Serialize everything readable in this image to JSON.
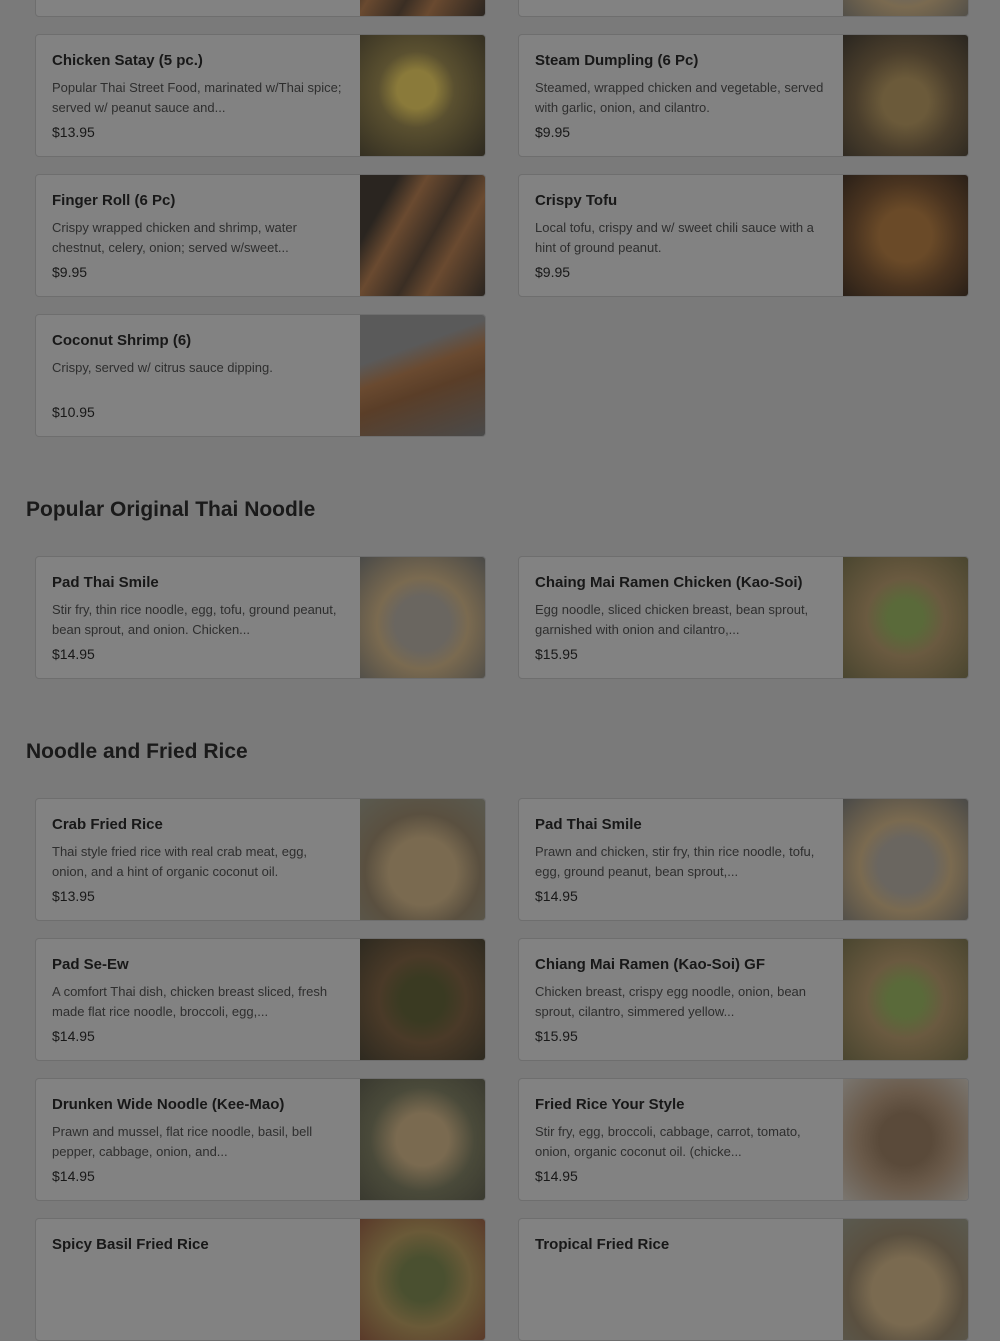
{
  "sections": [
    {
      "title": ""
    },
    {
      "title": "Popular Original Thai Noodle"
    },
    {
      "title": "Noodle and Fried Rice"
    }
  ],
  "items": [
    {
      "name": "Chicken Satay (5 pc.)",
      "desc": "Popular Thai Street Food, marinated w/Thai spice; served w/ peanut sauce and...",
      "price": "$13.95",
      "image": "chicken-satay-photo"
    },
    {
      "name": "Steam Dumpling (6 Pc)",
      "desc": "Steamed, wrapped chicken and vegetable, served with garlic, onion, and cilantro.",
      "price": "$9.95",
      "image": "dumpling-photo"
    },
    {
      "name": "Finger Roll (6 Pc)",
      "desc": "Crispy wrapped chicken and shrimp, water chestnut, celery, onion; served w/sweet...",
      "price": "$9.95",
      "image": "finger-roll-photo"
    },
    {
      "name": "Crispy Tofu",
      "desc": "Local tofu, crispy and w/ sweet chili sauce with a hint of ground peanut.",
      "price": "$9.95",
      "image": "crispy-tofu-photo"
    },
    {
      "name": "Coconut Shrimp (6)",
      "desc": "Crispy, served w/ citrus sauce dipping.",
      "price": "$10.95",
      "image": "coconut-shrimp-photo"
    },
    {
      "name": "Pad Thai Smile",
      "desc": "Stir fry, thin rice noodle, egg, tofu, ground peanut, bean sprout, and onion. Chicken...",
      "price": "$14.95",
      "image": "pad-thai-photo"
    },
    {
      "name": "Chaing Mai Ramen Chicken (Kao-Soi)",
      "desc": "Egg noodle, sliced chicken breast, bean sprout, garnished with onion and cilantro,...",
      "price": "$15.95",
      "image": "kao-soi-photo"
    },
    {
      "name": "Crab Fried Rice",
      "desc": "Thai style fried rice with real crab meat, egg, onion, and a hint of organic coconut oil.",
      "price": "$13.95",
      "image": "crab-fried-rice-photo"
    },
    {
      "name": "Pad Thai Smile",
      "desc": "Prawn and chicken, stir fry, thin rice noodle, tofu, egg, ground peanut, bean sprout,...",
      "price": "$14.95",
      "image": "pad-thai-photo"
    },
    {
      "name": "Pad Se-Ew",
      "desc": "A comfort Thai dish, chicken breast sliced, fresh made flat rice noodle, broccoli, egg,...",
      "price": "$14.95",
      "image": "pad-se-ew-photo"
    },
    {
      "name": "Chiang Mai Ramen (Kao-Soi) GF",
      "desc": "Chicken breast, crispy egg noodle, onion, bean sprout, cilantro, simmered yellow...",
      "price": "$15.95",
      "image": "kao-soi-photo"
    },
    {
      "name": "Drunken Wide Noodle (Kee-Mao)",
      "desc": "Prawn and mussel, flat rice noodle, basil, bell pepper, cabbage, onion, and...",
      "price": "$14.95",
      "image": "drunken-noodle-photo"
    },
    {
      "name": "Fried Rice Your Style",
      "desc": "Stir fry, egg, broccoli, cabbage, carrot, tomato, onion, organic coconut oil. (chicke...",
      "price": "$14.95",
      "image": "fried-rice-photo"
    },
    {
      "name": "Spicy Basil Fried Rice",
      "desc": "",
      "price": "",
      "image": "basil-fried-rice-photo"
    },
    {
      "name": "Tropical Fried Rice",
      "desc": "",
      "price": "",
      "image": "tropical-fried-rice-photo"
    }
  ]
}
